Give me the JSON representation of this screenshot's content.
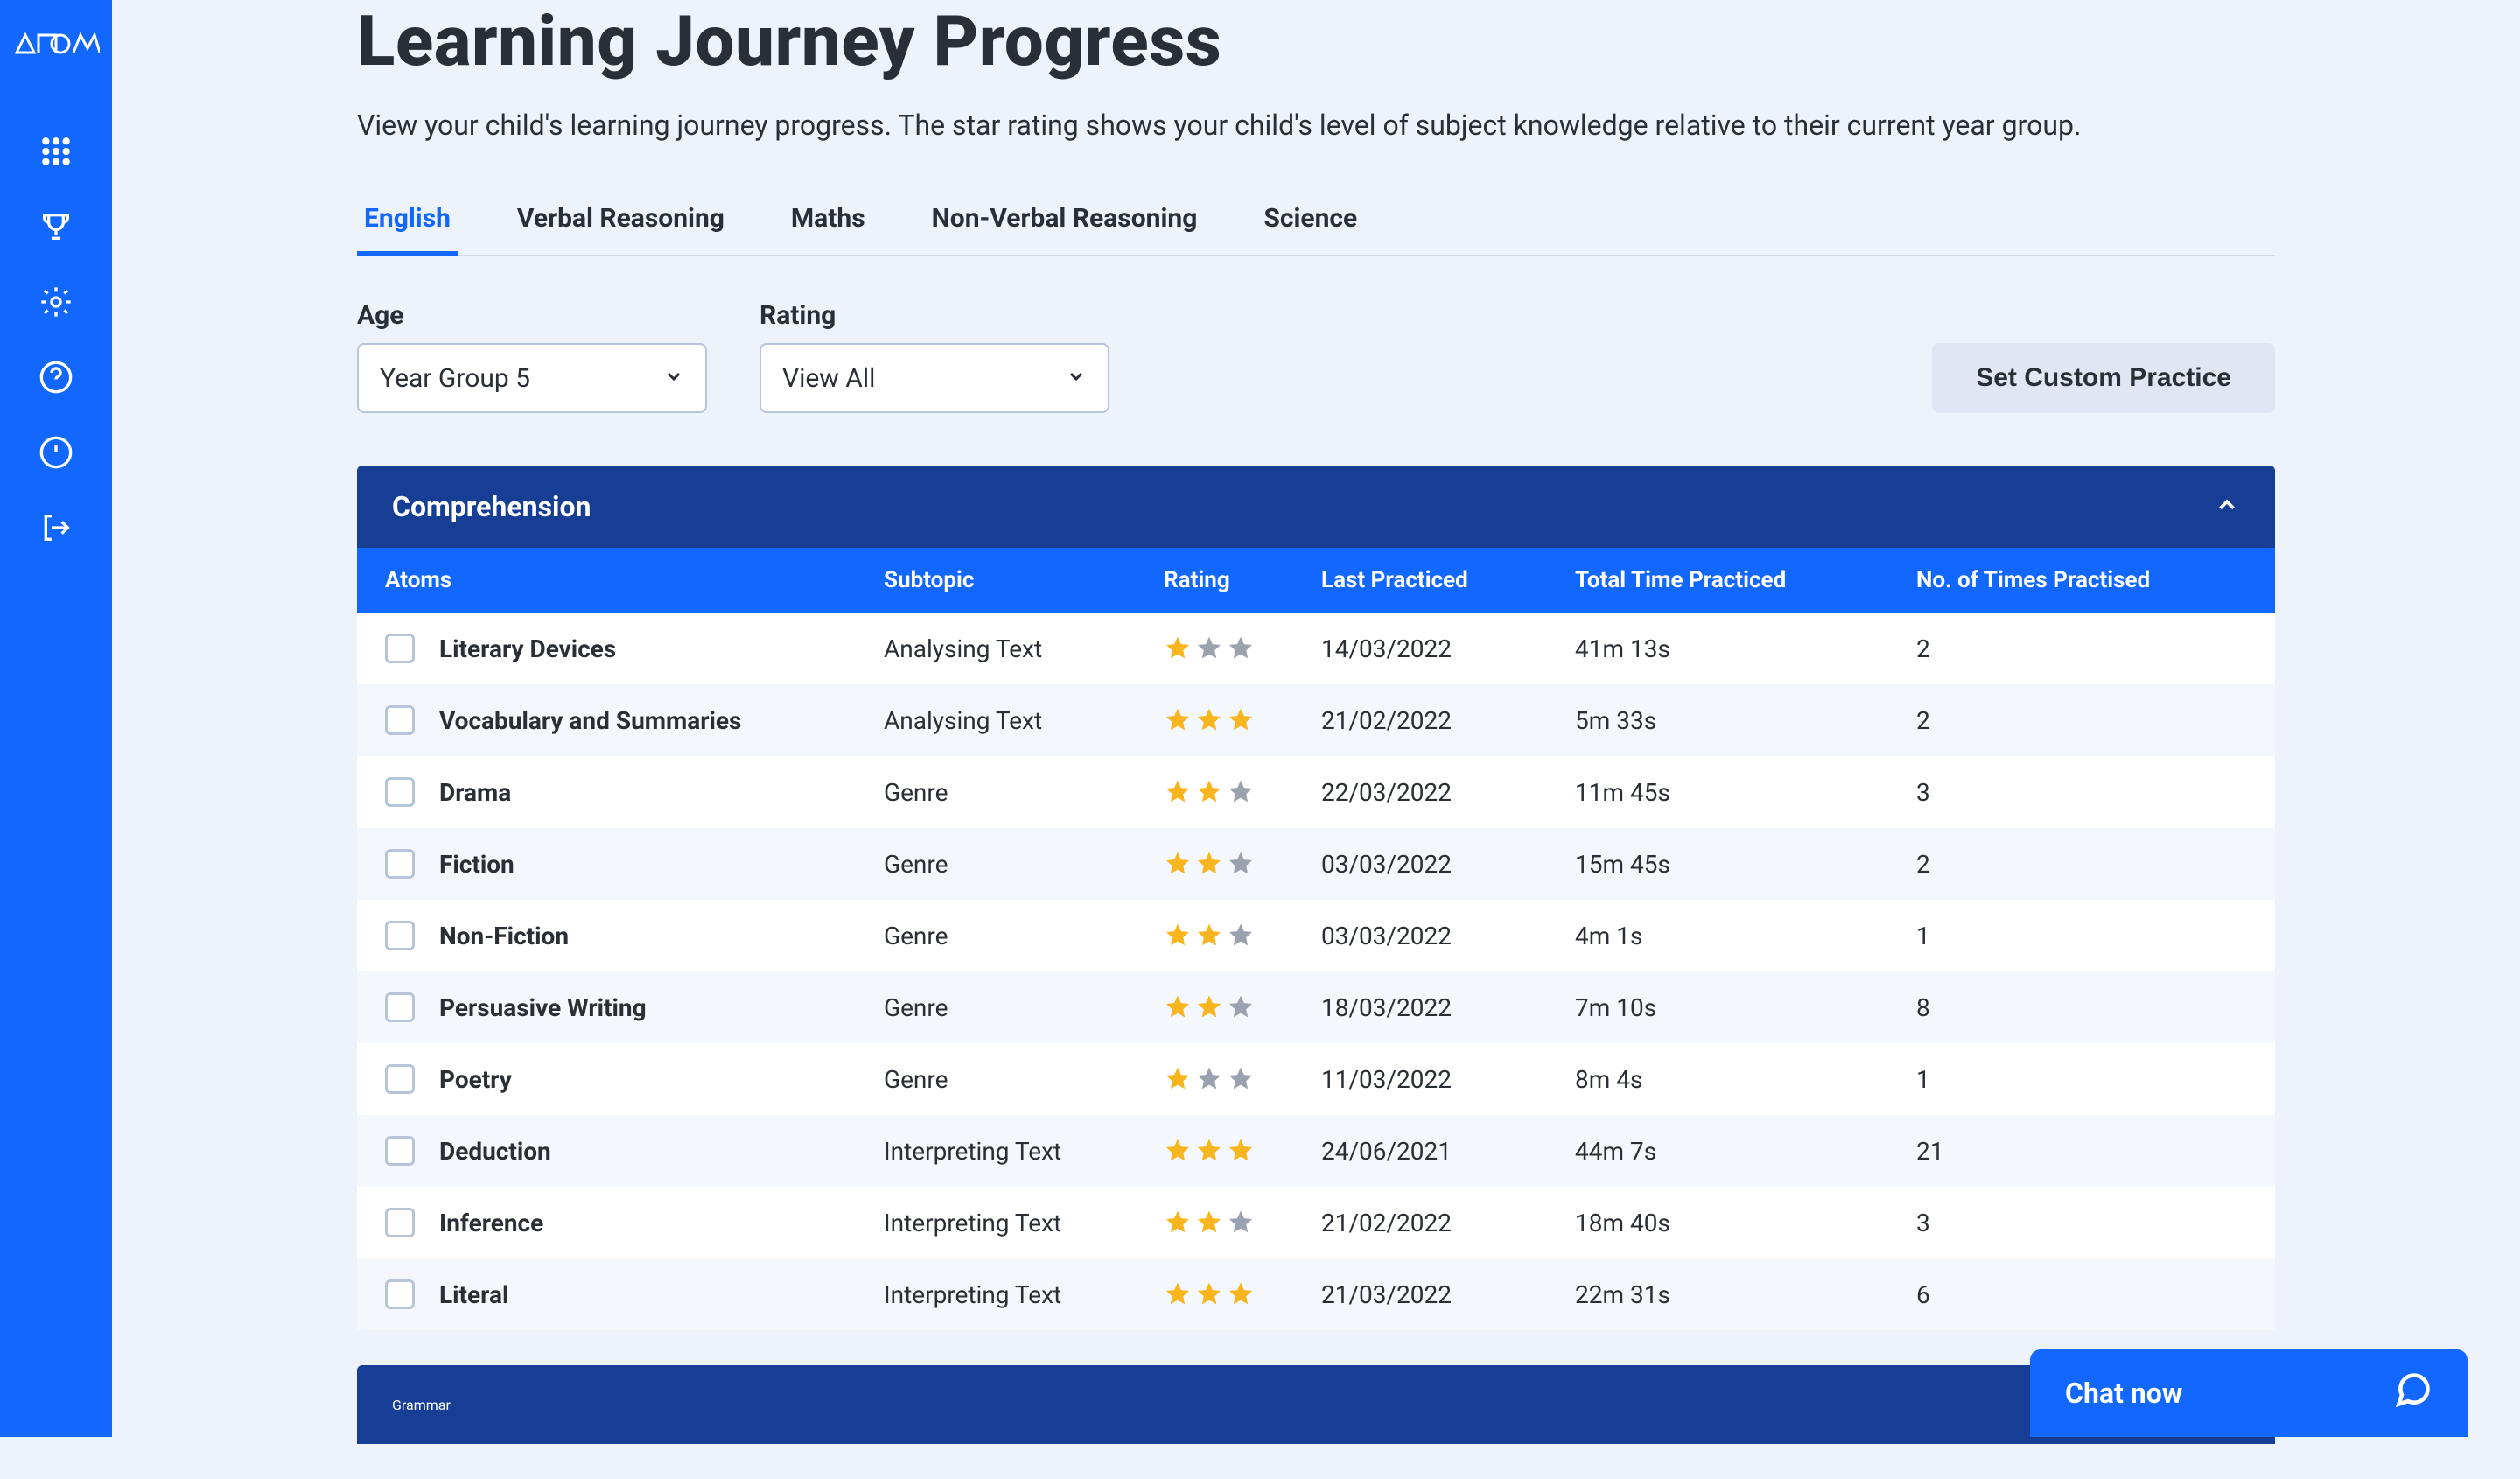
{
  "logo": "atom",
  "header": {
    "title": "Learning Journey Progress",
    "subtitle": "View your child's learning journey progress. The star rating shows your child's level of subject knowledge relative to their current year group."
  },
  "tabs": [
    {
      "label": "English",
      "active": true
    },
    {
      "label": "Verbal Reasoning",
      "active": false
    },
    {
      "label": "Maths",
      "active": false
    },
    {
      "label": "Non-Verbal Reasoning",
      "active": false
    },
    {
      "label": "Science",
      "active": false
    }
  ],
  "filters": {
    "age_label": "Age",
    "age_value": "Year Group 5",
    "rating_label": "Rating",
    "rating_value": "View All",
    "set_practice": "Set Custom Practice"
  },
  "section1": {
    "title": "Comprehension",
    "columns": [
      "Atoms",
      "Subtopic",
      "Rating",
      "Last Practiced",
      "Total Time Practiced",
      "No. of Times Practised"
    ],
    "rows": [
      {
        "atom": "Literary Devices",
        "subtopic": "Analysing Text",
        "rating": 1,
        "last": "14/03/2022",
        "time": "41m 13s",
        "count": "2"
      },
      {
        "atom": "Vocabulary and Summaries",
        "subtopic": "Analysing Text",
        "rating": 3,
        "last": "21/02/2022",
        "time": "5m 33s",
        "count": "2"
      },
      {
        "atom": "Drama",
        "subtopic": "Genre",
        "rating": 2,
        "last": "22/03/2022",
        "time": "11m 45s",
        "count": "3"
      },
      {
        "atom": "Fiction",
        "subtopic": "Genre",
        "rating": 2,
        "last": "03/03/2022",
        "time": "15m 45s",
        "count": "2"
      },
      {
        "atom": "Non-Fiction",
        "subtopic": "Genre",
        "rating": 2,
        "last": "03/03/2022",
        "time": "4m 1s",
        "count": "1"
      },
      {
        "atom": "Persuasive Writing",
        "subtopic": "Genre",
        "rating": 2,
        "last": "18/03/2022",
        "time": "7m 10s",
        "count": "8"
      },
      {
        "atom": "Poetry",
        "subtopic": "Genre",
        "rating": 1,
        "last": "11/03/2022",
        "time": "8m 4s",
        "count": "1"
      },
      {
        "atom": "Deduction",
        "subtopic": "Interpreting Text",
        "rating": 3,
        "last": "24/06/2021",
        "time": "44m 7s",
        "count": "21"
      },
      {
        "atom": "Inference",
        "subtopic": "Interpreting Text",
        "rating": 2,
        "last": "21/02/2022",
        "time": "18m 40s",
        "count": "3"
      },
      {
        "atom": "Literal",
        "subtopic": "Interpreting Text",
        "rating": 3,
        "last": "21/03/2022",
        "time": "22m 31s",
        "count": "6"
      }
    ]
  },
  "section2": {
    "title": "Grammar"
  },
  "chat": {
    "label": "Chat now"
  }
}
